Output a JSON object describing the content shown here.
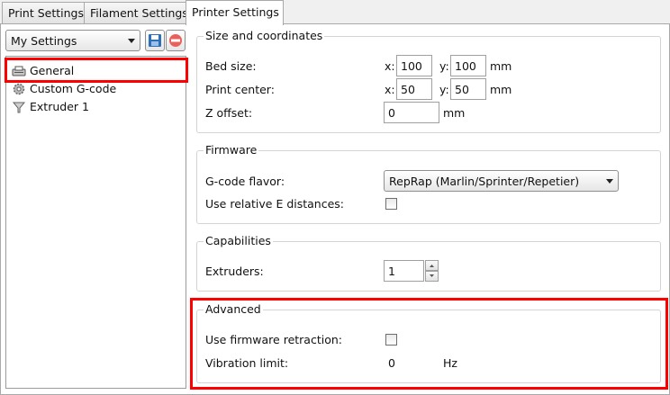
{
  "tabs": [
    {
      "label": "Print Settings"
    },
    {
      "label": "Filament Settings"
    },
    {
      "label": "Printer Settings"
    }
  ],
  "profile": {
    "selected": "My Settings"
  },
  "tree": [
    {
      "label": "General",
      "icon": "printer-icon"
    },
    {
      "label": "Custom G-code",
      "icon": "gear-icon"
    },
    {
      "label": "Extruder 1",
      "icon": "funnel-icon"
    }
  ],
  "size": {
    "legend": "Size and coordinates",
    "bed_label": "Bed size:",
    "center_label": "Print center:",
    "z_label": "Z offset:",
    "x_prefix": "x:",
    "y_prefix": "y:",
    "bed_x": "100",
    "bed_y": "100",
    "center_x": "50",
    "center_y": "50",
    "z_offset": "0",
    "unit": "mm"
  },
  "firmware": {
    "legend": "Firmware",
    "flavor_label": "G-code flavor:",
    "flavor_value": "RepRap (Marlin/Sprinter/Repetier)",
    "relative_label": "Use relative E distances:"
  },
  "capabilities": {
    "legend": "Capabilities",
    "extruders_label": "Extruders:",
    "extruders_value": "1"
  },
  "advanced": {
    "legend": "Advanced",
    "retraction_label": "Use firmware retraction:",
    "vibration_label": "Vibration limit:",
    "vibration_value": "0",
    "vibration_unit": "Hz"
  },
  "colors": {
    "highlight": "#ff0000",
    "save": "#2d6fb9",
    "delete": "#d9342b"
  }
}
